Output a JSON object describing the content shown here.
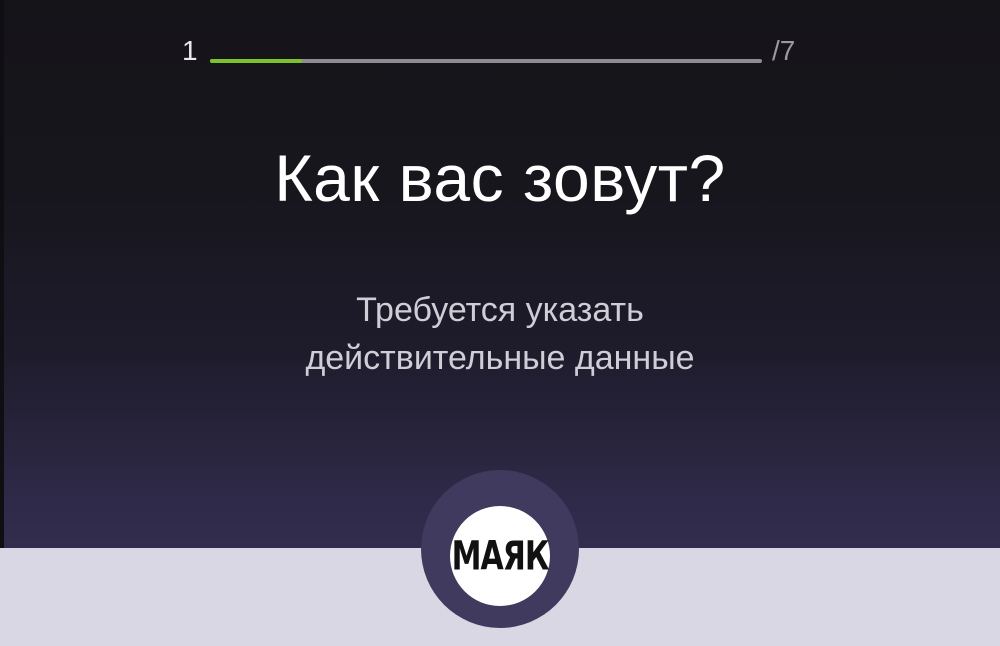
{
  "progress": {
    "current": "1",
    "total": "/7",
    "fill_fraction": 0.167,
    "fill_color": "#7bc22c",
    "track_color": "#8d8c91"
  },
  "question": {
    "title": "Как вас зовут?",
    "subtitle_line1": "Требуется указать",
    "subtitle_line2": "действительные данные"
  },
  "logo": {
    "text": "МАЯК",
    "icon": "mayak-logo-icon"
  },
  "colors": {
    "bottom_panel": "#d9d7e3",
    "notch": "#3f3a5e"
  }
}
